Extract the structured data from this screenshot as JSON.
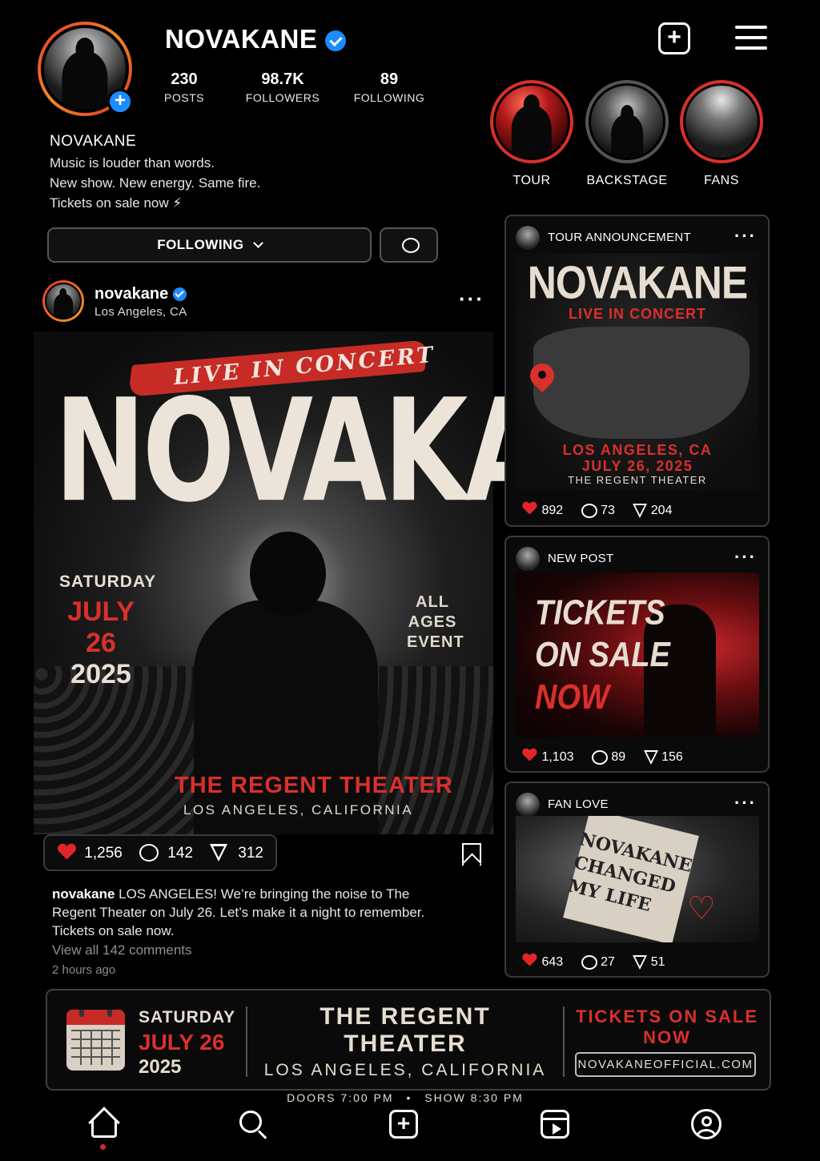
{
  "profile": {
    "username": "NOVAKANE",
    "display_name": "NOVAKANE",
    "stats": [
      {
        "value": "230",
        "label": "POSTS"
      },
      {
        "value": "98.7K",
        "label": "FOLLOWERS"
      },
      {
        "value": "89",
        "label": "FOLLOWING"
      }
    ],
    "bio": [
      "Music is louder than words.",
      "New show. New energy. Same fire.",
      "Tickets on sale now ⚡"
    ],
    "following_button": "FOLLOWING",
    "highlights": [
      {
        "label": "TOUR"
      },
      {
        "label": "BACKSTAGE"
      },
      {
        "label": "FANS"
      }
    ]
  },
  "post": {
    "username": "novakane",
    "location": "Los Angeles, CA",
    "poster": {
      "subtitle": "LIVE IN CONCERT",
      "title": "NOVAKANE",
      "day": "SATURDAY",
      "date": "JULY 26",
      "year": "2025",
      "ages": [
        "ALL",
        "AGES",
        "EVENT"
      ],
      "venue": "THE REGENT THEATER",
      "city": "LOS ANGELES, CALIFORNIA"
    },
    "likes": "1,256",
    "comments": "142",
    "shares": "312",
    "caption_user": "novakane",
    "caption_text": "LOS ANGELES! We’re bringing the noise to The Regent Theater on July 26. Let’s make it a night to remember. Tickets on sale now.",
    "view_comments": "View all 142 comments",
    "time_ago": "2 hours ago"
  },
  "cards": [
    {
      "title": "TOUR ANNOUNCEMENT",
      "art": {
        "title": "NOVAKANE",
        "subtitle": "LIVE IN CONCERT",
        "city": "LOS ANGELES, CA",
        "date": "JULY 26, 2025",
        "venue": "THE REGENT THEATER"
      },
      "likes": "892",
      "comments": "73",
      "shares": "204"
    },
    {
      "title": "NEW POST",
      "art": {
        "line1": "TICKETS",
        "line2": "ON SALE",
        "line3": "NOW"
      },
      "likes": "1,103",
      "comments": "89",
      "shares": "156"
    },
    {
      "title": "FAN LOVE",
      "art": {
        "line1": "NOVAKANE",
        "line2": "CHANGED",
        "line3": "MY LIFE"
      },
      "likes": "643",
      "comments": "27",
      "shares": "51"
    }
  ],
  "banner": {
    "day": "SATURDAY",
    "date": "JULY 26",
    "year": "2025",
    "venue": "THE REGENT THEATER",
    "city": "LOS ANGELES, CALIFORNIA",
    "doors": "DOORS 7:00 PM",
    "show": "SHOW 8:30 PM",
    "cta_line1": "TICKETS ON SALE",
    "cta_line2": "NOW",
    "website": "NOVAKANEOFFICIAL.COM"
  },
  "nav": {
    "items": [
      "home-icon",
      "search-icon",
      "create-icon",
      "reels-icon",
      "profile-icon"
    ],
    "active": "home-icon"
  },
  "colors": {
    "accent": "#d9302c",
    "verified": "#1a8cff",
    "background": "#000000"
  }
}
